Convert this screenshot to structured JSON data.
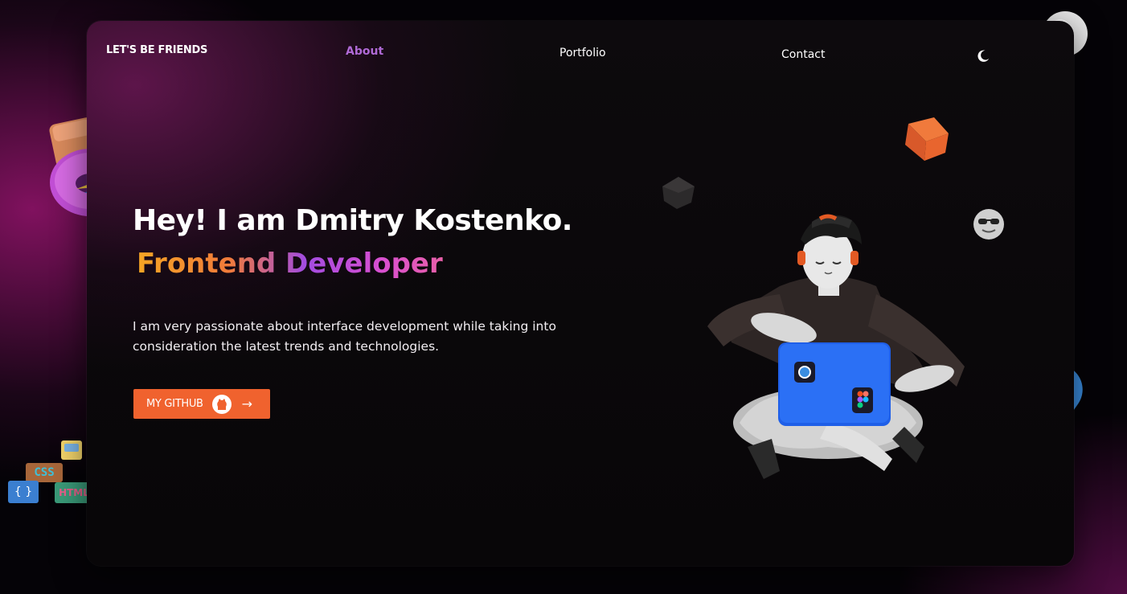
{
  "nav": {
    "brand": "LET'S BE FRIENDS",
    "links": [
      {
        "label": "About",
        "active": true
      },
      {
        "label": "Portfolio",
        "active": false
      },
      {
        "label": "Contact",
        "active": false
      }
    ],
    "theme_icon": "moon-icon"
  },
  "hero": {
    "greeting": "Hey! I am Dmitry Kostenko.",
    "role": "Frontend Developer",
    "description": "I am very passionate about interface development while taking into consideration the latest trends and technologies.",
    "cta_label": "MY GITHUB",
    "cta_icon": "github-icon",
    "cta_arrow": "→"
  },
  "colors": {
    "accent": "#f0622e",
    "active_link": "#b06ad6",
    "gradient": [
      "#f5a524",
      "#a24ce0",
      "#e85fa8"
    ]
  },
  "decor": {
    "css_block": "CSS",
    "html_block": "HTML",
    "braces_block": "{ }"
  }
}
